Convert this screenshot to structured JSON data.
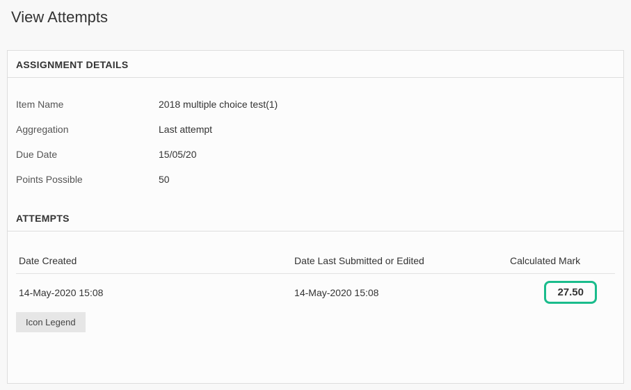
{
  "page": {
    "title": "View Attempts"
  },
  "assignment": {
    "section_label": "ASSIGNMENT DETAILS",
    "rows": {
      "item_name_label": "Item Name",
      "item_name_value": "2018 multiple choice test(1)",
      "aggregation_label": "Aggregation",
      "aggregation_value": "Last attempt",
      "due_date_label": "Due Date",
      "due_date_value": "15/05/20",
      "points_label": "Points Possible",
      "points_value": "50"
    }
  },
  "attempts": {
    "section_label": "ATTEMPTS",
    "headers": {
      "date_created": "Date Created",
      "date_submitted": "Date Last Submitted or Edited",
      "calc_mark": "Calculated Mark"
    },
    "row": {
      "date_created": "14-May-2020 15:08",
      "date_submitted": "14-May-2020 15:08",
      "calc_mark": "27.50"
    },
    "icon_legend_label": "Icon Legend"
  }
}
